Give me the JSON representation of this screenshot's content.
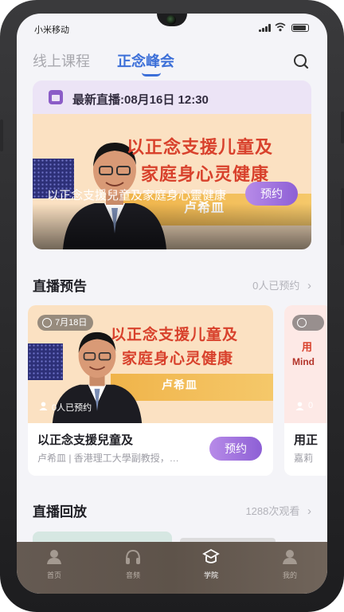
{
  "status_bar": {
    "carrier": "小米移动"
  },
  "top_nav": {
    "tabs": [
      {
        "label": "线上课程",
        "active": false
      },
      {
        "label": "正念峰会",
        "active": true
      }
    ],
    "search_icon": "search-icon"
  },
  "hero": {
    "live_label": "最新直播:08月16日 12:30",
    "poster_title_line1": "以正念支援儿童及",
    "poster_title_line2": "家庭身心灵健康",
    "poster_name": "卢希皿",
    "caption": "以正念支援兒童及家庭身心靈健康",
    "button": "预约"
  },
  "preview_section": {
    "title": "直播预告",
    "meta": "0人已预约",
    "cards": [
      {
        "date": "7月18日",
        "poster_title_line1": "以正念支援儿童及",
        "poster_title_line2": "家庭身心灵健康",
        "poster_name": "卢希皿",
        "reserved": "0人已预约",
        "title": "以正念支援兒童及",
        "subtitle": "卢希皿 | 香港理工大學副教授，…",
        "button": "预约"
      },
      {
        "poster_title": "用",
        "poster_sub": "Mind",
        "reserved": "0",
        "title": "用正",
        "subtitle": "嘉莉"
      }
    ]
  },
  "playback_section": {
    "title": "直播回放",
    "meta": "1288次观看"
  },
  "tab_bar": [
    {
      "label": "首页",
      "icon": "home-icon",
      "active": false
    },
    {
      "label": "音频",
      "icon": "headphones-icon",
      "active": false
    },
    {
      "label": "学院",
      "icon": "academy-icon",
      "active": true
    },
    {
      "label": "我的",
      "icon": "profile-icon",
      "active": false
    }
  ],
  "colors": {
    "accent": "#3c6fd8",
    "button": "#9a6bdc",
    "poster_title": "#d8412c",
    "tab_bar": "#61564d"
  }
}
